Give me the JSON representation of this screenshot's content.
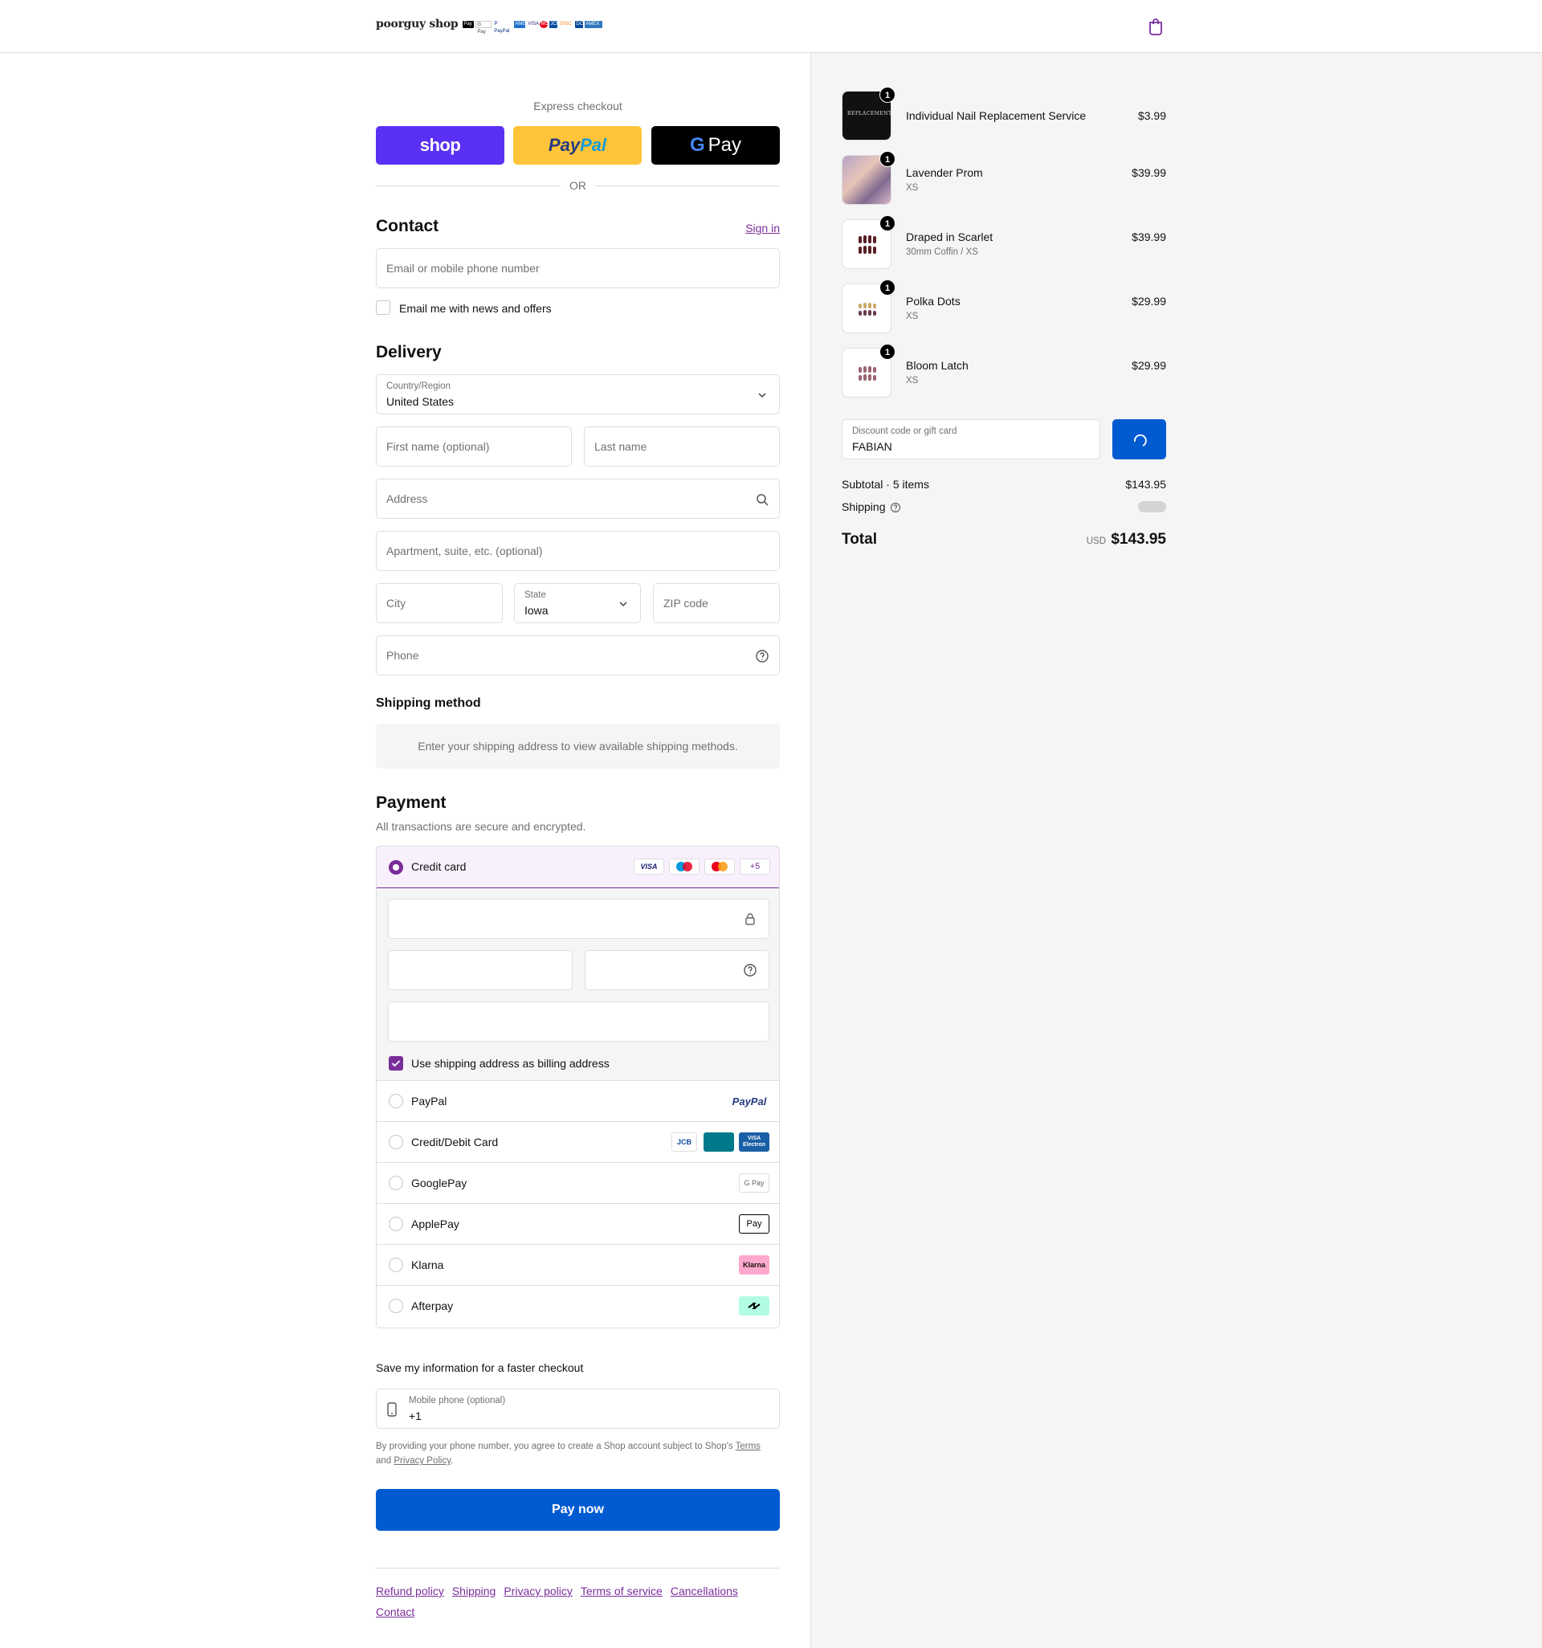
{
  "header": {
    "brand": "poorguy shop",
    "brand_strip": [
      "Pay",
      "G Pay",
      "P PayPal",
      "AMEX",
      "VISA",
      "MC",
      "JCB",
      "DISC",
      "DC",
      "AMEX"
    ]
  },
  "express": {
    "title": "Express checkout",
    "shop_label": "shop",
    "paypal_label_a": "Pay",
    "paypal_label_b": "Pal",
    "gpay_g": "G",
    "gpay_label": "Pay",
    "or_label": "OR"
  },
  "contact": {
    "title": "Contact",
    "sign_in": "Sign in",
    "email_placeholder": "Email or mobile phone number",
    "newsletter_label": "Email me with news and offers"
  },
  "delivery": {
    "title": "Delivery",
    "country_label": "Country/Region",
    "country_value": "United States",
    "first_name_placeholder": "First name (optional)",
    "last_name_placeholder": "Last name",
    "address_placeholder": "Address",
    "apartment_placeholder": "Apartment, suite, etc. (optional)",
    "city_placeholder": "City",
    "state_label": "State",
    "state_value": "Iowa",
    "zip_placeholder": "ZIP code",
    "phone_placeholder": "Phone"
  },
  "shipping_method": {
    "title": "Shipping method",
    "message": "Enter your shipping address to view available shipping methods."
  },
  "payment": {
    "title": "Payment",
    "subtitle": "All transactions are secure and encrypted.",
    "credit_card_label": "Credit card",
    "card_badges": [
      "VISA",
      "",
      "",
      "+5"
    ],
    "billing_label": "Use shipping address as billing address",
    "methods": [
      {
        "label": "PayPal",
        "badge": "PayPal"
      },
      {
        "label": "Credit/Debit Card",
        "badge": "JCB"
      },
      {
        "label": "GooglePay",
        "badge": "G Pay"
      },
      {
        "label": "ApplePay",
        "badge": "Pay"
      },
      {
        "label": "Klarna",
        "badge": "Klarna"
      },
      {
        "label": "Afterpay",
        "badge": ""
      }
    ],
    "extra_badges": [
      "",
      "VISA Electron"
    ]
  },
  "save_info": {
    "title": "Save my information for a faster checkout",
    "phone_label": "Mobile phone (optional)",
    "phone_value": "+1",
    "legal_a": "By providing your phone number, you agree to create a Shop account subject to Shop's ",
    "legal_terms": "Terms",
    "legal_and": "and ",
    "legal_privacy": "Privacy Policy",
    "legal_end": "."
  },
  "pay_now": "Pay now",
  "footer_links": [
    "Refund policy",
    "Shipping",
    "Privacy policy",
    "Terms of service",
    "Cancellations",
    "Contact"
  ],
  "summary": {
    "items": [
      {
        "qty": "1",
        "name": "Individual Nail Replacement Service",
        "variant": "",
        "price": "$3.99",
        "thumb_text": "REPLACEMENT"
      },
      {
        "qty": "1",
        "name": "Lavender Prom",
        "variant": "XS",
        "price": "$39.99"
      },
      {
        "qty": "1",
        "name": "Draped in Scarlet",
        "variant": "30mm Coffin / XS",
        "price": "$39.99"
      },
      {
        "qty": "1",
        "name": "Polka Dots",
        "variant": "XS",
        "price": "$29.99"
      },
      {
        "qty": "1",
        "name": "Bloom Latch",
        "variant": "XS",
        "price": "$29.99"
      }
    ],
    "discount_label": "Discount code or gift card",
    "discount_value": "FABIAN",
    "subtotal_label": "Subtotal · 5 items",
    "subtotal_value": "$143.95",
    "shipping_label": "Shipping",
    "total_label": "Total",
    "currency": "USD",
    "total_value": "$143.95"
  },
  "colors": {
    "accent": "#7a2e9a",
    "primary_button": "#005bd1",
    "shop_pay": "#5a31f4",
    "paypal": "#ffc439"
  }
}
